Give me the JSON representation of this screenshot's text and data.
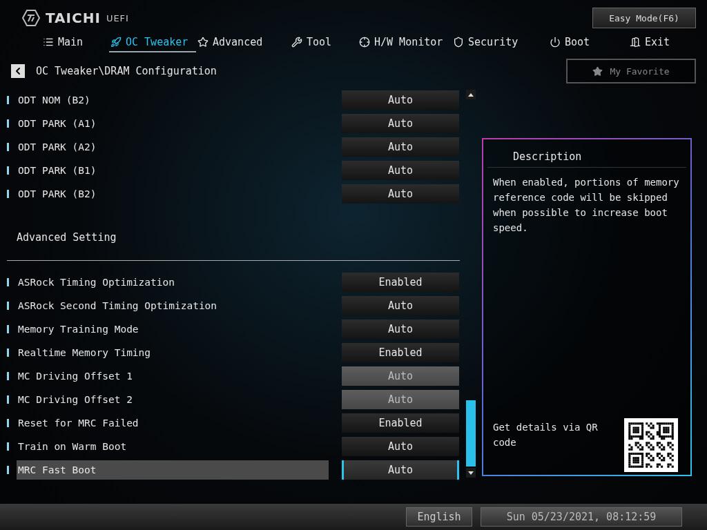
{
  "brand": {
    "name": "TAICHI",
    "sub": "UEFI"
  },
  "easy_mode_button": "Easy Mode(F6)",
  "tabs": [
    {
      "label": "Main",
      "selected": false
    },
    {
      "label": "OC Tweaker",
      "selected": true
    },
    {
      "label": "Advanced",
      "selected": false
    },
    {
      "label": "Tool",
      "selected": false
    },
    {
      "label": "H/W Monitor",
      "selected": false
    },
    {
      "label": "Security",
      "selected": false
    },
    {
      "label": "Boot",
      "selected": false
    },
    {
      "label": "Exit",
      "selected": false
    }
  ],
  "breadcrumb": "OC Tweaker\\DRAM Configuration",
  "favorite_button": "My Favorite",
  "settings": [
    {
      "kind": "setting",
      "label": "ODT NOM  (B2)",
      "value": "Auto",
      "disabled": false,
      "selected": false
    },
    {
      "kind": "setting",
      "label": "ODT PARK (A1)",
      "value": "Auto",
      "disabled": false,
      "selected": false
    },
    {
      "kind": "setting",
      "label": "ODT PARK (A2)",
      "value": "Auto",
      "disabled": false,
      "selected": false
    },
    {
      "kind": "setting",
      "label": "ODT PARK (B1)",
      "value": "Auto",
      "disabled": false,
      "selected": false
    },
    {
      "kind": "setting",
      "label": "ODT PARK (B2)",
      "value": "Auto",
      "disabled": false,
      "selected": false
    },
    {
      "kind": "heading",
      "label": "Advanced Setting"
    },
    {
      "kind": "setting",
      "label": "ASRock Timing Optimization",
      "value": "Enabled",
      "disabled": false,
      "selected": false
    },
    {
      "kind": "setting",
      "label": "ASRock Second Timing Optimization",
      "value": "Auto",
      "disabled": false,
      "selected": false
    },
    {
      "kind": "setting",
      "label": "Memory Training Mode",
      "value": "Auto",
      "disabled": false,
      "selected": false
    },
    {
      "kind": "setting",
      "label": "Realtime Memory Timing",
      "value": "Enabled",
      "disabled": false,
      "selected": false
    },
    {
      "kind": "setting",
      "label": "MC Driving Offset 1",
      "value": "Auto",
      "disabled": true,
      "selected": false
    },
    {
      "kind": "setting",
      "label": "MC Driving Offset 2",
      "value": "Auto",
      "disabled": true,
      "selected": false
    },
    {
      "kind": "setting",
      "label": "Reset for MRC Failed",
      "value": "Enabled",
      "disabled": false,
      "selected": false
    },
    {
      "kind": "setting",
      "label": "Train on Warm Boot",
      "value": "Auto",
      "disabled": false,
      "selected": false
    },
    {
      "kind": "setting",
      "label": "MRC Fast Boot",
      "value": "Auto",
      "disabled": false,
      "selected": true
    }
  ],
  "description": {
    "title": "Description",
    "text": "When enabled, portions of memory reference code will be skipped when possible to increase boot speed.",
    "qr_text": "Get details via QR code"
  },
  "status_bar": {
    "language": "English",
    "datetime": "Sun 05/23/2021, 08:12:59"
  }
}
